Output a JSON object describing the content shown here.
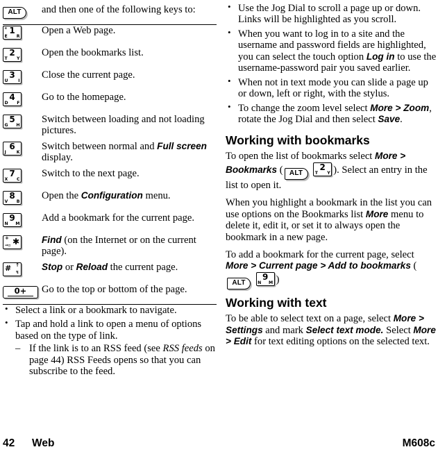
{
  "document": {
    "footer": {
      "page_number": "42",
      "section": "Web",
      "model": "M608c"
    }
  },
  "left_column": {
    "intro_row": {
      "key": {
        "type": "alt",
        "label": "ALT"
      },
      "description": "and then one of the following keys to:"
    },
    "shortcut_rows": [
      {
        "key": {
          "type": "num",
          "digit": "1",
          "left": "E",
          "right": "R",
          "top_left": "¤"
        },
        "description": "Open a Web page."
      },
      {
        "key": {
          "type": "num",
          "digit": "2",
          "left": "T",
          "right": "Y"
        },
        "description": "Open the bookmarks list."
      },
      {
        "key": {
          "type": "num",
          "digit": "3",
          "left": "U",
          "right": "I"
        },
        "description": "Close the current page."
      },
      {
        "key": {
          "type": "num",
          "digit": "4",
          "left": "D",
          "right": "F"
        },
        "description": "Go to the homepage."
      },
      {
        "key": {
          "type": "num",
          "digit": "5",
          "left": "G",
          "right": "H"
        },
        "description": "Switch between loading and not loading pictures."
      },
      {
        "key": {
          "type": "num",
          "digit": "6",
          "left": "J",
          "right": "K"
        },
        "description_html": "Switch between normal and <b class=\"ui\">Full screen</b> display."
      },
      {
        "key": {
          "type": "num",
          "digit": "7",
          "left": "X",
          "right": "C"
        },
        "description": "Switch to the next page."
      },
      {
        "key": {
          "type": "num",
          "digit": "8",
          "left": "V",
          "right": "B"
        },
        "description_html": "Open the <b class=\"ui\">Configuration</b> menu."
      },
      {
        "key": {
          "type": "num",
          "digit": "9",
          "left": "N",
          "right": "M"
        },
        "description": "Add a bookmark for the current page."
      },
      {
        "key": {
          "type": "star",
          "big": "✱",
          "small_top": "+",
          "small_bottom": "→▫"
        },
        "description_html": "<b class=\"ui\">Find</b> (on the Internet or on the current page)."
      },
      {
        "key": {
          "type": "hash",
          "big": "#",
          "small_top": "↑",
          "small_bottom": "↯"
        },
        "description_html": "<b class=\"ui\">Stop</b> or <b class=\"ui\">Reload</b> the current page."
      },
      {
        "key": {
          "type": "zero",
          "label": "0+"
        },
        "description": "Go to the top or bottom of the page."
      }
    ],
    "bullets": [
      {
        "text": "Select a link or a bookmark to navigate."
      },
      {
        "text": "Tap and hold a link to open a menu of options based on the type of link.",
        "sub": [
          {
            "text_html": "If the link is to an RSS feed (see <i class=\"ref\">RSS feeds</i> on page 44) RSS Feeds opens so that you can subscribe to the feed."
          }
        ]
      }
    ]
  },
  "right_column": {
    "bullets": [
      {
        "text_html": "Use the Jog Dial to scroll a page up or down. Links will be highlighted as you scroll."
      },
      {
        "text_html": "When you want to log in to a site and the username and password fields are highlighted, you can select the touch option <b class=\"ui\">Log in</b> to use the username-password pair you saved earlier."
      },
      {
        "text_html": "When not in text mode you can slide a page up or down, left or right, with the stylus."
      },
      {
        "text_html": "To change the zoom level select <b class=\"ui\">More &gt; Zoom</b>, rotate the Jog Dial and then select <b class=\"ui\">Save</b>."
      }
    ],
    "sections": [
      {
        "heading": "Working with bookmarks",
        "paragraphs": [
          {
            "html": "To open the list of bookmarks select <b class=\"ui\">More &gt; Bookmarks</b> (<span class=\"key key-alt inline\" data-name=\"key-alt-inline\" data-interactable=\"false\">ALT</span> <span class=\"key key-num inline\" data-name=\"key-2-inline\" data-interactable=\"false\"><span class=\"digit\">2</span><span class=\"lt\">T</span><span class=\"rt\">Y</span></span>). Select an entry in the list to open it."
          },
          {
            "html": "When you highlight a bookmark in the list you can use options on the Bookmarks list <b class=\"ui\">More</b> menu to delete it, edit it, or set it to always open the bookmark in a new page."
          },
          {
            "html": "To add a bookmark for the current page, select <b class=\"ui\">More &gt; Current page &gt; Add to bookmarks</b> (<span class=\"key key-alt inline\" data-name=\"key-alt-inline\" data-interactable=\"false\">ALT</span> <span class=\"key key-num inline\" data-name=\"key-9-inline\" data-interactable=\"false\"><span class=\"digit\">9</span><span class=\"lt\">N</span><span class=\"rt\">M</span></span>)"
          }
        ]
      },
      {
        "heading": "Working with text",
        "paragraphs": [
          {
            "html": "To be able to select text on a page, select <b class=\"ui\">More &gt; Settings</b> and mark <b class=\"ui\">Select text mode.</b> Select <b class=\"ui\">More &gt; Edit</b> for text editing options on the selected text."
          }
        ]
      }
    ]
  }
}
